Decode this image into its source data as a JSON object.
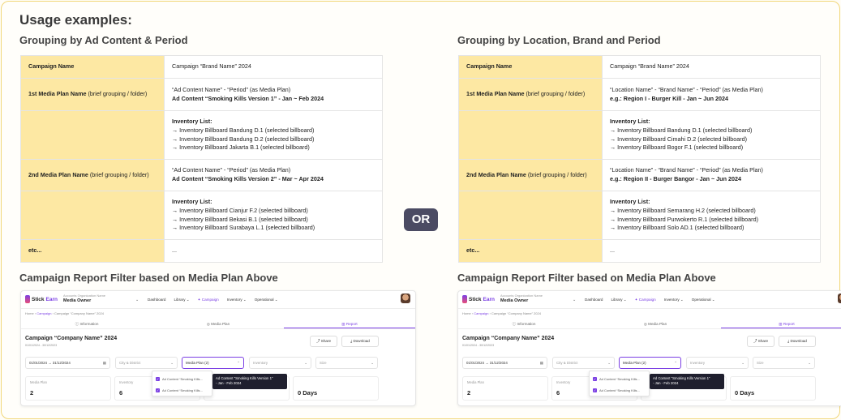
{
  "title": "Usage examples:",
  "or_label": "OR",
  "left": {
    "heading": "Grouping by Ad Content & Period",
    "rows": [
      {
        "label_bold": "Campaign Name",
        "label_rest": "",
        "lines": [
          {
            "t": "Campaign \"",
            "b": false
          }
        ],
        "raw": "Campaign “Brand Name” 2024"
      },
      {
        "label_bold": "1st Media Plan Name",
        "label_rest": " (brief grouping / folder)",
        "val": [
          "“Ad Content Name” - “Period” (as Media Plan)"
        ],
        "val_bold": "Ad Content “Smoking Kills Version 1” - Jan ~ Feb 2024"
      },
      {
        "label_bold": "",
        "label_rest": "",
        "inv_title": "Inventory List:",
        "inv": [
          "→ Inventory Billboard Bandung D.1 (selected billboard)",
          "→ Inventory Billboard Bandung D.2 (selected billboard)",
          "→ Inventory Billboard Jakarta B.1 (selected billboard)"
        ]
      },
      {
        "label_bold": "2nd Media Plan Name",
        "label_rest": "  (brief grouping / folder)",
        "val": [
          "“Ad Content Name” - “Period” (as Media Plan)"
        ],
        "val_bold": "Ad Content “Smoking Kills Version 2” - Mar ~ Apr 2024"
      },
      {
        "label_bold": "",
        "label_rest": "",
        "inv_title": "Inventory List:",
        "inv": [
          "→ Inventory Billboard Cianjur F.2 (selected billboard)",
          "→ Inventory Billboard Bekasi B.1 (selected billboard)",
          "→ Inventory Billboard Surabaya L.1 (selected billboard)"
        ]
      },
      {
        "label_bold": "etc...",
        "label_rest": "",
        "raw": "..."
      }
    ],
    "report_heading": "Campaign Report Filter based on Media Plan Above"
  },
  "right": {
    "heading": "Grouping by Location, Brand and Period",
    "rows": [
      {
        "label_bold": "Campaign Name",
        "label_rest": "",
        "raw": "Campaign “Brand Name” 2024"
      },
      {
        "label_bold": "1st Media Plan Name",
        "label_rest": " (brief grouping / folder)",
        "val": [
          "“Location Name” - “Brand Name” - “Period” (as Media Plan)"
        ],
        "val_bold": "e.g.: Region I - Burger Kill - Jan ~ Jun 2024"
      },
      {
        "label_bold": "",
        "label_rest": "",
        "inv_title": "Inventory List:",
        "inv": [
          "→ Inventory Billboard Bandung D.1 (selected billboard)",
          "→ Inventory Billboard Cimahi D.2 (selected billboard)",
          "→ Inventory Billboard Bogor F.1 (selected billboard)"
        ]
      },
      {
        "label_bold": "2nd Media Plan Name",
        "label_rest": "  (brief grouping / folder)",
        "val": [
          "“Location Name” - “Brand Name” - “Period” (as Media Plan)"
        ],
        "val_bold": "e.g.: Region II - Burger Bangor - Jan ~ Jun 2024"
      },
      {
        "label_bold": "",
        "label_rest": "",
        "inv_title": "Inventory List:",
        "inv": [
          "→ Inventory Billboard Semarang H.2 (selected billboard)",
          "→ Inventory Billboard Purwokerto R.1 (selected billboard)",
          "→ Inventory Billboard Solo AD.1 (selected billboard)"
        ]
      },
      {
        "label_bold": "etc...",
        "label_rest": "",
        "raw": "..."
      }
    ],
    "report_heading": "Campaign Report Filter based on Media Plan Above"
  },
  "app": {
    "logo_a": "Stick",
    "logo_b": "Earn",
    "account_caption": "Accounts   Organization Name",
    "account_owner": "Media Owner",
    "menu": [
      "Dashboard",
      "Library ⌄",
      "Campaign",
      "Inventory ⌄",
      "Operational ⌄"
    ],
    "breadcrumb_home": "Home",
    "breadcrumb_campaign": "Campaign",
    "breadcrumb_current": "Campaign “Company Name” 2024",
    "tabs": [
      "Information",
      "Media Plan",
      "Report"
    ],
    "heading": "Campaign “Company Name” 2024",
    "dates": "01/01/2024 - 30/12/2023",
    "share": "Share",
    "download": "Download",
    "date_from": "01/01/2024",
    "date_to": "31/12/2024",
    "city": "City & District",
    "media_plan": "Media Plan (2)",
    "inventory": "Inventory",
    "size": "Size",
    "option_1": "Ad Content “Smoking Kills...",
    "option_2": "Ad Content “Smoking Kills...",
    "tooltip_1": "Ad Content “Smoking Kills Version 1”",
    "tooltip_2": "- Jan - Feb 2024",
    "card_1_label": "Media Plan",
    "card_1_value": "2",
    "card_2_label": "Inventory",
    "card_2_value": "6",
    "card_4_value": "0 Days"
  },
  "colors": {
    "label_bg": "#fde8a3",
    "accent": "#7b3fe4",
    "or_bg": "#4b4b63"
  }
}
